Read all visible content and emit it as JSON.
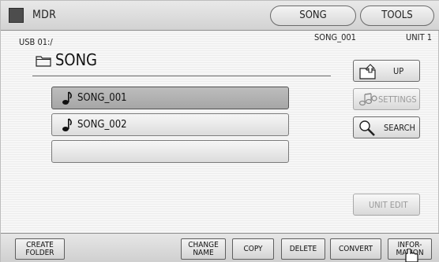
{
  "titlebar": {
    "title": "MDR",
    "tabs": [
      {
        "label": "SONG"
      },
      {
        "label": "TOOLS"
      }
    ]
  },
  "browser": {
    "drive_path": "USB 01:/",
    "selected_song": "SONG_001",
    "unit_label": "UNIT 1",
    "folder_name": "SONG",
    "files": [
      {
        "name": "SONG_001",
        "selected": true
      },
      {
        "name": "SONG_002",
        "selected": false
      },
      {
        "name": "",
        "selected": false
      }
    ]
  },
  "side_buttons": {
    "up": "UP",
    "settings": "SETTINGS",
    "search": "SEARCH",
    "unit_edit": "UNIT EDIT"
  },
  "bottom_buttons": {
    "create_folder": "CREATE\nFOLDER",
    "change_name": "CHANGE\nNAME",
    "copy": "COPY",
    "delete": "DELETE",
    "convert": "CONVERT",
    "information": "INFOR-\nMATION"
  },
  "icons": {
    "app": "app-square-icon",
    "folder": "folder-icon",
    "note": "music-note-icon",
    "up": "folder-up-icon",
    "settings": "notes-settings-icon",
    "search": "magnifier-icon",
    "cursor": "hand-pointer-icon"
  },
  "colors": {
    "selected_row": "#a6a6a6",
    "disabled_text": "#9a9a9a"
  }
}
